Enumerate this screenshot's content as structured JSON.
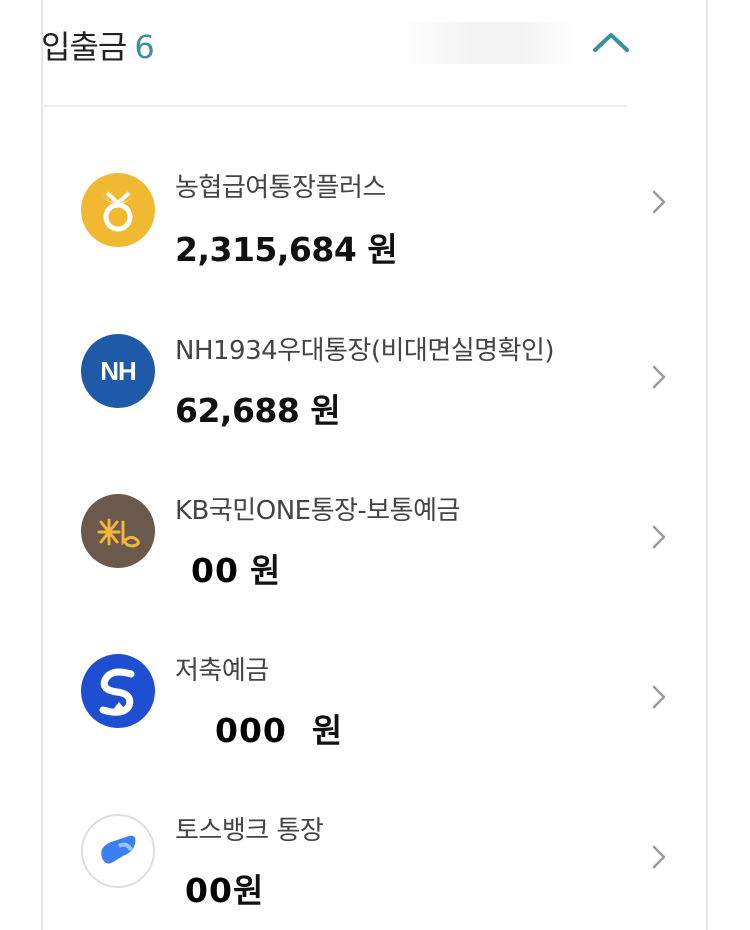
{
  "header": {
    "title": "입출금",
    "count": "6"
  },
  "accounts": [
    {
      "name": "농협급여통장플러스",
      "balance": "2,315,684",
      "unit": "원",
      "logo": "nh-gold-icon",
      "logo_color": "#f0b931"
    },
    {
      "name": "NH1934우대통장(비대면실명확인)",
      "balance": "62,688",
      "unit": "원",
      "logo": "nh-blue-icon",
      "logo_color": "#1e5aa8",
      "logo_text": "NH"
    },
    {
      "name": "KB국민ONE통장-보통예금",
      "balance": "00",
      "unit": "원",
      "logo": "kb-icon",
      "logo_color": "#6b5a4b"
    },
    {
      "name": "저축예금",
      "balance": "000",
      "unit": "원",
      "logo": "shinhan-icon",
      "logo_color": "#1f4fd1"
    },
    {
      "name": "토스뱅크 통장",
      "balance": "00",
      "unit": "원",
      "logo": "toss-icon",
      "logo_color": "#3d7ef0"
    }
  ],
  "colors": {
    "accent": "#3a8f9b",
    "chevron": "#9a9a9a"
  }
}
